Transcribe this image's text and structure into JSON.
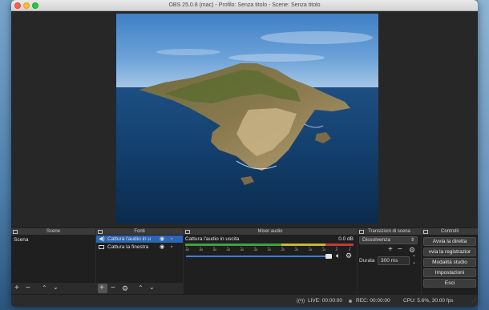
{
  "window": {
    "title": "OBS 25.0.8 (mac) - Profilo: Senza titolo - Scene: Senza titolo"
  },
  "docks": {
    "scenes": "Scene",
    "sources": "Fonti",
    "mixer": "Mixer audio",
    "transitions": "Transizioni di scena",
    "controls": "Controlli"
  },
  "scenes": {
    "items": [
      "Scena"
    ]
  },
  "sources": {
    "items": [
      {
        "label": "Cattura l'audio in u",
        "type": "audio",
        "selected": true
      },
      {
        "label": "Cattura la finestra",
        "type": "window",
        "selected": false
      }
    ]
  },
  "mixer": {
    "channel_name": "Cattura l'audio in uscita",
    "level": "0.0 dB",
    "scale": [
      "-60",
      "-55",
      "-50",
      "-45",
      "-40",
      "-35",
      "-30",
      "-25",
      "-20",
      "-15",
      "-10",
      "-5",
      "0"
    ],
    "volume_fraction": 1.0
  },
  "transitions": {
    "selected": "Dissolvenza",
    "duration_label": "Durata",
    "duration_value": "300 ms"
  },
  "controls": {
    "start_stream": "Avvia la diretta",
    "start_recording": "vvia la registrazior",
    "studio_mode": "Modalità studio",
    "settings": "Impostazioni",
    "exit": "Esci"
  },
  "status": {
    "live": "LIVE: 00:00:00",
    "rec": "REC: 00:00:00",
    "cpu": "CPU: 5.6%, 30.00 fps"
  },
  "colors": {
    "selection": "#2c65b5",
    "panel_bg": "#1f1f1f",
    "meter_green": "#3fa33f",
    "meter_yellow": "#c8b63a",
    "meter_red": "#c23b3b",
    "volume_blue": "#3b7fd1"
  }
}
